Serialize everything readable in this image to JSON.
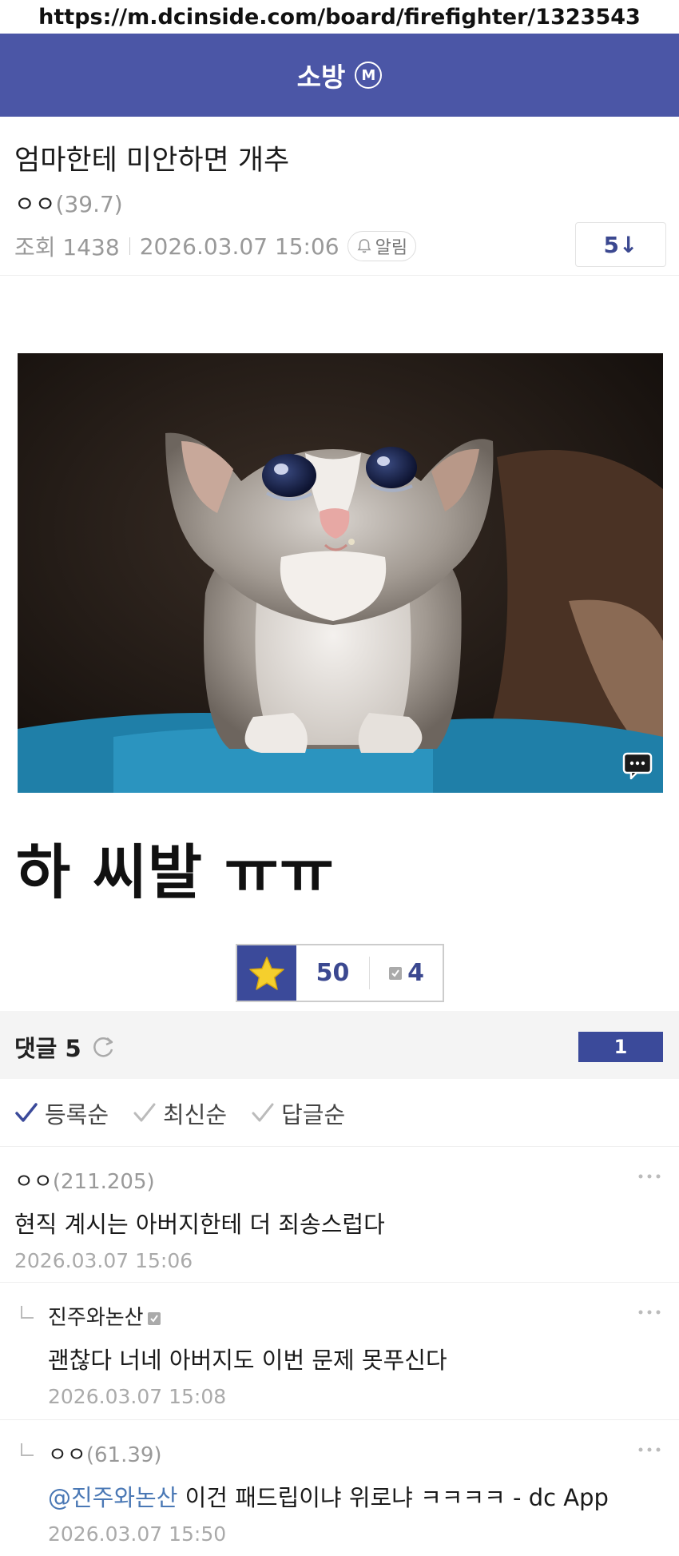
{
  "url": "https://m.dcinside.com/board/firefighter/1323543",
  "gallery": {
    "name": "소방",
    "badge": "M"
  },
  "post": {
    "title": "엄마한테 미안하면 개추",
    "author": "ㅇㅇ",
    "author_ip": "(39.7)",
    "views_label": "조회 1438",
    "date": "2026.03.07 15:06",
    "alarm_label": "알림",
    "comment_jump": "5↓",
    "body_text": "하 씨발 ㅠㅠ",
    "reco_count": "50",
    "nonreco_count": "4"
  },
  "comments_header": {
    "title": "댓글 5",
    "page": "1"
  },
  "sort_options": [
    "등록순",
    "최신순",
    "답글순"
  ],
  "comments": [
    {
      "author": "ㅇㅇ",
      "ip": "(211.205)",
      "text": "현직 계시는 아버지한테 더 죄송스럽다",
      "date": "2026.03.07 15:06"
    },
    {
      "author": "진주와논산",
      "ip": "",
      "text": "괜찮다 너네 아버지도 이번 문제 못푸신다",
      "date": "2026.03.07 15:08"
    },
    {
      "author": "ㅇㅇ",
      "ip": "(61.39)",
      "mention": "@진주와논산",
      "text": " 이건 패드립이냐 위로냐 ㅋㅋㅋㅋ - dc App",
      "date": "2026.03.07 15:50"
    }
  ],
  "colors": {
    "header": "#4b56a6",
    "accent": "#3b4a9a",
    "mention": "#4a78b5"
  },
  "icons": [
    "bell-icon",
    "star-icon",
    "refresh-icon",
    "check-icon",
    "more-icon",
    "comment-bubble-icon"
  ]
}
